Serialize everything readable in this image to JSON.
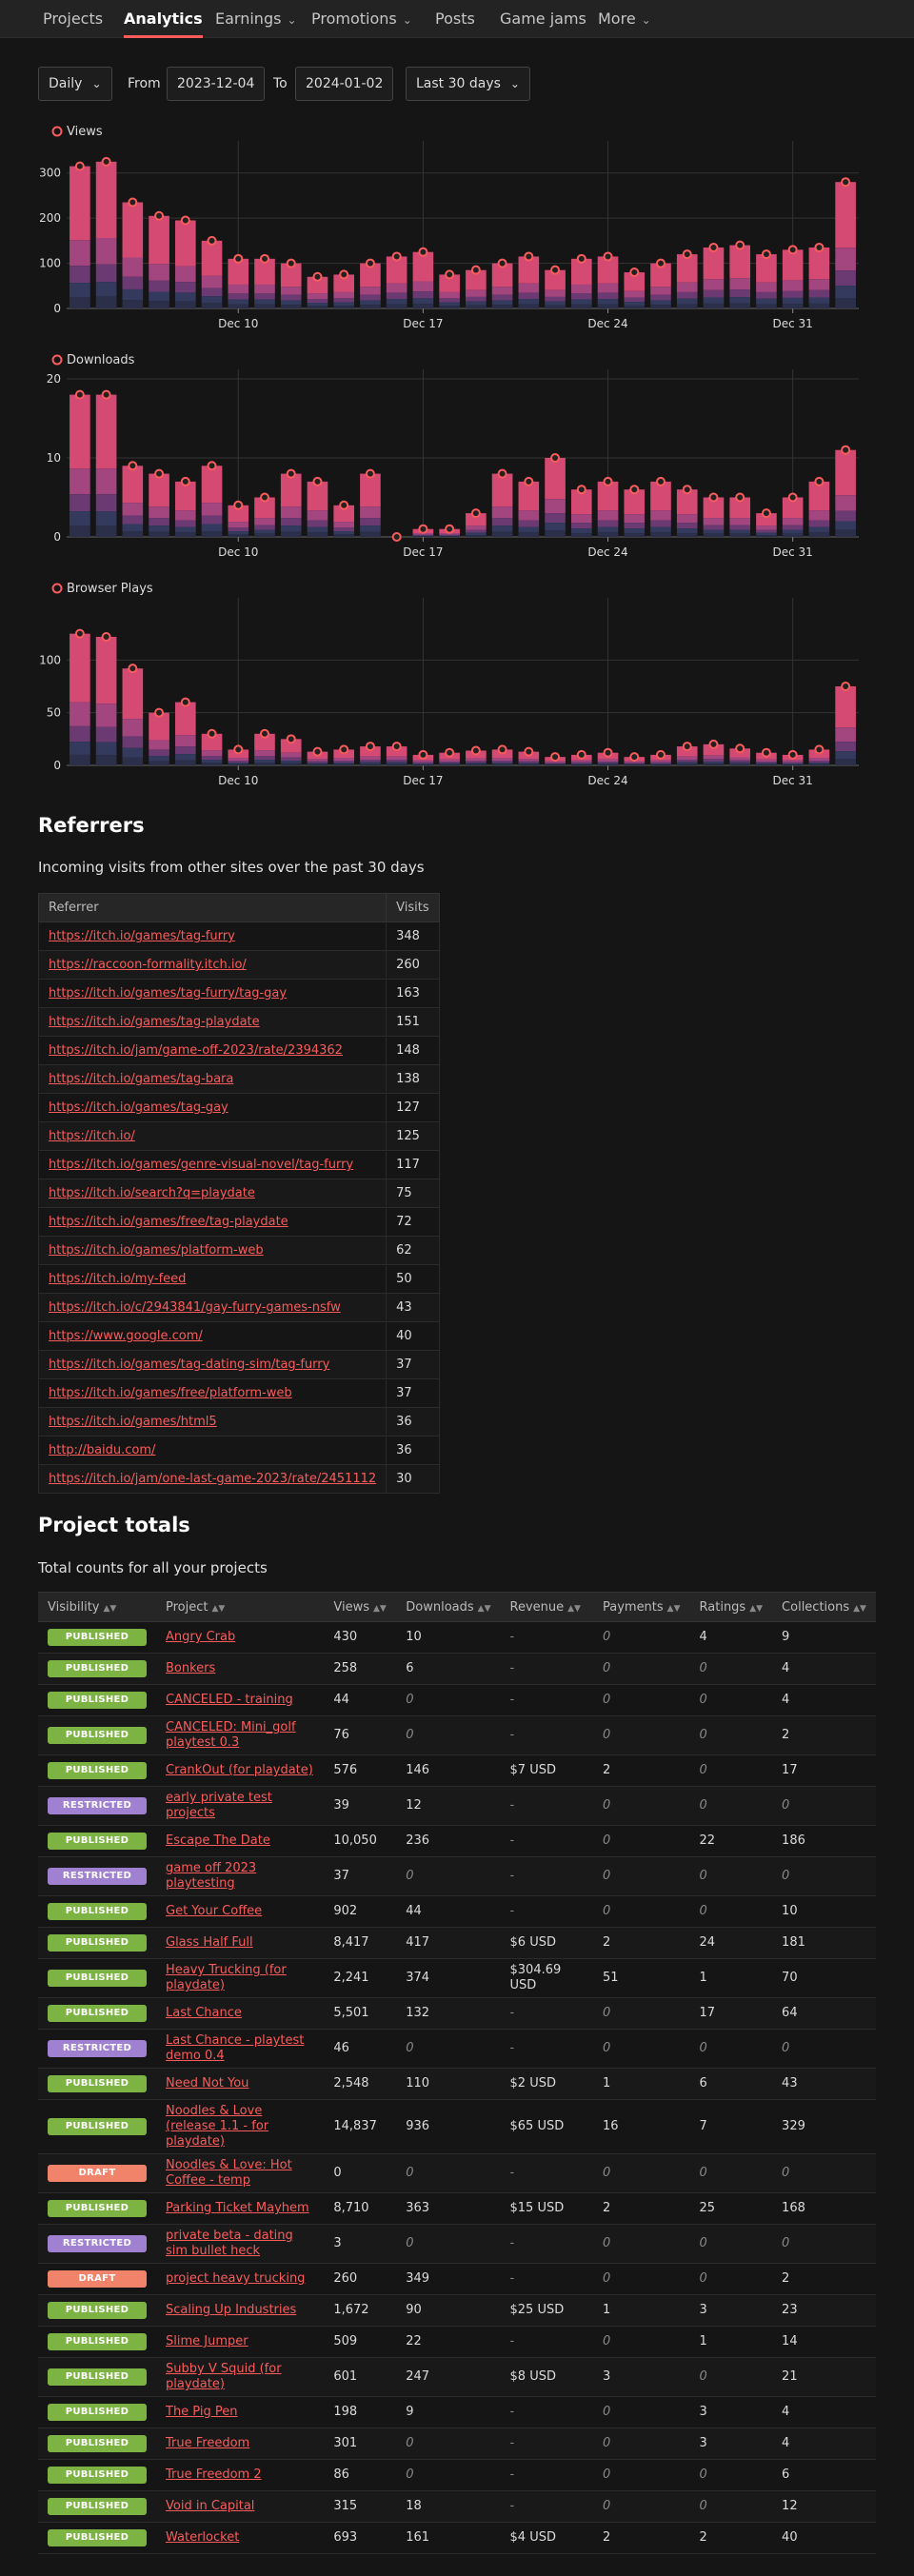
{
  "nav": {
    "items": [
      {
        "label": "Projects",
        "dropdown": false
      },
      {
        "label": "Analytics",
        "dropdown": false,
        "active": true
      },
      {
        "label": "Earnings",
        "dropdown": true
      },
      {
        "label": "Promotions",
        "dropdown": true
      },
      {
        "label": "Posts",
        "dropdown": false
      },
      {
        "label": "Game jams",
        "dropdown": false
      },
      {
        "label": "More",
        "dropdown": true
      }
    ]
  },
  "controls": {
    "interval": "Daily",
    "from_label": "From",
    "from_value": "2023-12-04",
    "to_label": "To",
    "to_value": "2024-01-02",
    "range": "Last 30 days"
  },
  "colors": {
    "accent": "#fa5c5c",
    "navy": "#333a5e",
    "purple": "#6b3a72",
    "published": "#7cb342",
    "restricted": "#a080d0",
    "draft": "#f2836b"
  },
  "chart_data": [
    {
      "type": "bar",
      "title": "Views",
      "categories": [
        "2023-12-04",
        "2023-12-05",
        "2023-12-06",
        "2023-12-07",
        "2023-12-08",
        "2023-12-09",
        "2023-12-10",
        "2023-12-11",
        "2023-12-12",
        "2023-12-13",
        "2023-12-14",
        "2023-12-15",
        "2023-12-16",
        "2023-12-17",
        "2023-12-18",
        "2023-12-19",
        "2023-12-20",
        "2023-12-21",
        "2023-12-22",
        "2023-12-23",
        "2023-12-24",
        "2023-12-25",
        "2023-12-26",
        "2023-12-27",
        "2023-12-28",
        "2023-12-29",
        "2023-12-30",
        "2023-12-31",
        "2024-01-01",
        "2024-01-02"
      ],
      "values": [
        315,
        325,
        235,
        205,
        195,
        150,
        110,
        110,
        100,
        70,
        75,
        100,
        115,
        125,
        75,
        85,
        100,
        115,
        85,
        110,
        115,
        80,
        100,
        120,
        135,
        140,
        120,
        130,
        135,
        280
      ],
      "xticks": [
        "Dec 10",
        "Dec 17",
        "Dec 24",
        "Dec 31"
      ],
      "ylim": [
        0,
        350
      ],
      "yticks": [
        0,
        100,
        200,
        300
      ],
      "stacked": true
    },
    {
      "type": "bar",
      "title": "Downloads",
      "categories": [
        "2023-12-04",
        "2023-12-05",
        "2023-12-06",
        "2023-12-07",
        "2023-12-08",
        "2023-12-09",
        "2023-12-10",
        "2023-12-11",
        "2023-12-12",
        "2023-12-13",
        "2023-12-14",
        "2023-12-15",
        "2023-12-16",
        "2023-12-17",
        "2023-12-18",
        "2023-12-19",
        "2023-12-20",
        "2023-12-21",
        "2023-12-22",
        "2023-12-23",
        "2023-12-24",
        "2023-12-25",
        "2023-12-26",
        "2023-12-27",
        "2023-12-28",
        "2023-12-29",
        "2023-12-30",
        "2023-12-31",
        "2024-01-01",
        "2024-01-02"
      ],
      "values": [
        18,
        18,
        9,
        8,
        7,
        9,
        4,
        5,
        8,
        7,
        4,
        8,
        0,
        1,
        1,
        3,
        8,
        7,
        10,
        6,
        7,
        6,
        7,
        6,
        5,
        5,
        3,
        5,
        7,
        11
      ],
      "xticks": [
        "Dec 10",
        "Dec 17",
        "Dec 24",
        "Dec 31"
      ],
      "ylim": [
        0,
        20
      ],
      "yticks": [
        0,
        10,
        20
      ],
      "stacked": true
    },
    {
      "type": "bar",
      "title": "Browser Plays",
      "categories": [
        "2023-12-04",
        "2023-12-05",
        "2023-12-06",
        "2023-12-07",
        "2023-12-08",
        "2023-12-09",
        "2023-12-10",
        "2023-12-11",
        "2023-12-12",
        "2023-12-13",
        "2023-12-14",
        "2023-12-15",
        "2023-12-16",
        "2023-12-17",
        "2023-12-18",
        "2023-12-19",
        "2023-12-20",
        "2023-12-21",
        "2023-12-22",
        "2023-12-23",
        "2023-12-24",
        "2023-12-25",
        "2023-12-26",
        "2023-12-27",
        "2023-12-28",
        "2023-12-29",
        "2023-12-30",
        "2023-12-31",
        "2024-01-01",
        "2024-01-02"
      ],
      "values": [
        125,
        122,
        92,
        50,
        60,
        30,
        15,
        30,
        25,
        13,
        15,
        18,
        18,
        10,
        12,
        14,
        15,
        13,
        8,
        10,
        12,
        8,
        10,
        18,
        20,
        16,
        12,
        10,
        15,
        75
      ],
      "xticks": [
        "Dec 10",
        "Dec 17",
        "Dec 24",
        "Dec 31"
      ],
      "ylim": [
        0,
        150
      ],
      "yticks": [
        0,
        50,
        100
      ],
      "stacked": true
    }
  ],
  "referrers": {
    "title": "Referrers",
    "subtitle": "Incoming visits from other sites over the past 30 days",
    "headers": [
      "Referrer",
      "Visits"
    ],
    "rows": [
      [
        "https://itch.io/games/tag-furry",
        "348"
      ],
      [
        "https://raccoon-formality.itch.io/",
        "260"
      ],
      [
        "https://itch.io/games/tag-furry/tag-gay",
        "163"
      ],
      [
        "https://itch.io/games/tag-playdate",
        "151"
      ],
      [
        "https://itch.io/jam/game-off-2023/rate/2394362",
        "148"
      ],
      [
        "https://itch.io/games/tag-bara",
        "138"
      ],
      [
        "https://itch.io/games/tag-gay",
        "127"
      ],
      [
        "https://itch.io/",
        "125"
      ],
      [
        "https://itch.io/games/genre-visual-novel/tag-furry",
        "117"
      ],
      [
        "https://itch.io/search?q=playdate",
        "75"
      ],
      [
        "https://itch.io/games/free/tag-playdate",
        "72"
      ],
      [
        "https://itch.io/games/platform-web",
        "62"
      ],
      [
        "https://itch.io/my-feed",
        "50"
      ],
      [
        "https://itch.io/c/2943841/gay-furry-games-nsfw",
        "43"
      ],
      [
        "https://www.google.com/",
        "40"
      ],
      [
        "https://itch.io/games/tag-dating-sim/tag-furry",
        "37"
      ],
      [
        "https://itch.io/games/free/platform-web",
        "37"
      ],
      [
        "https://itch.io/games/html5",
        "36"
      ],
      [
        "http://baidu.com/",
        "36"
      ],
      [
        "https://itch.io/jam/one-last-game-2023/rate/2451112",
        "30"
      ]
    ]
  },
  "projects": {
    "title": "Project totals",
    "subtitle": "Total counts for all your projects",
    "headers": [
      "Visibility",
      "Project",
      "Views",
      "Downloads",
      "Revenue",
      "Payments",
      "Ratings",
      "Collections"
    ],
    "rows": [
      [
        "PUBLISHED",
        "Angry Crab",
        "430",
        "10",
        "-",
        "0",
        "4",
        "9"
      ],
      [
        "PUBLISHED",
        "Bonkers",
        "258",
        "6",
        "-",
        "0",
        "0",
        "4"
      ],
      [
        "PUBLISHED",
        "CANCELED - training",
        "44",
        "0",
        "-",
        "0",
        "0",
        "4"
      ],
      [
        "PUBLISHED",
        "CANCELED: Mini_golf playtest 0.3",
        "76",
        "0",
        "-",
        "0",
        "0",
        "2"
      ],
      [
        "PUBLISHED",
        "CrankOut (for playdate)",
        "576",
        "146",
        "$7 USD",
        "2",
        "0",
        "17"
      ],
      [
        "RESTRICTED",
        "early private test projects",
        "39",
        "12",
        "-",
        "0",
        "0",
        "0"
      ],
      [
        "PUBLISHED",
        "Escape The Date",
        "10,050",
        "236",
        "-",
        "0",
        "22",
        "186"
      ],
      [
        "RESTRICTED",
        "game off 2023 playtesting",
        "37",
        "0",
        "-",
        "0",
        "0",
        "0"
      ],
      [
        "PUBLISHED",
        "Get Your Coffee",
        "902",
        "44",
        "-",
        "0",
        "0",
        "10"
      ],
      [
        "PUBLISHED",
        "Glass Half Full",
        "8,417",
        "417",
        "$6 USD",
        "2",
        "24",
        "181"
      ],
      [
        "PUBLISHED",
        "Heavy Trucking (for playdate)",
        "2,241",
        "374",
        "$304.69 USD",
        "51",
        "1",
        "70"
      ],
      [
        "PUBLISHED",
        "Last Chance",
        "5,501",
        "132",
        "-",
        "0",
        "17",
        "64"
      ],
      [
        "RESTRICTED",
        "Last Chance - playtest demo 0.4",
        "46",
        "0",
        "-",
        "0",
        "0",
        "0"
      ],
      [
        "PUBLISHED",
        "Need Not You",
        "2,548",
        "110",
        "$2 USD",
        "1",
        "6",
        "43"
      ],
      [
        "PUBLISHED",
        "Noodles & Love (release 1.1 - for playdate)",
        "14,837",
        "936",
        "$65 USD",
        "16",
        "7",
        "329"
      ],
      [
        "DRAFT",
        "Noodles & Love: Hot Coffee - temp",
        "0",
        "0",
        "-",
        "0",
        "0",
        "0"
      ],
      [
        "PUBLISHED",
        "Parking Ticket Mayhem",
        "8,710",
        "363",
        "$15 USD",
        "2",
        "25",
        "168"
      ],
      [
        "RESTRICTED",
        "private beta - dating sim bullet heck",
        "3",
        "0",
        "-",
        "0",
        "0",
        "0"
      ],
      [
        "DRAFT",
        "project heavy trucking",
        "260",
        "349",
        "-",
        "0",
        "0",
        "2"
      ],
      [
        "PUBLISHED",
        "Scaling Up Industries",
        "1,672",
        "90",
        "$25 USD",
        "1",
        "3",
        "23"
      ],
      [
        "PUBLISHED",
        "Slime Jumper",
        "509",
        "22",
        "-",
        "0",
        "1",
        "14"
      ],
      [
        "PUBLISHED",
        "Subby V Squid (for playdate)",
        "601",
        "247",
        "$8 USD",
        "3",
        "0",
        "21"
      ],
      [
        "PUBLISHED",
        "The Pig Pen",
        "198",
        "9",
        "-",
        "0",
        "3",
        "4"
      ],
      [
        "PUBLISHED",
        "True Freedom",
        "301",
        "0",
        "-",
        "0",
        "3",
        "4"
      ],
      [
        "PUBLISHED",
        "True Freedom 2",
        "86",
        "0",
        "-",
        "0",
        "0",
        "6"
      ],
      [
        "PUBLISHED",
        "Void in Capital",
        "315",
        "18",
        "-",
        "0",
        "0",
        "12"
      ],
      [
        "PUBLISHED",
        "Waterlocket",
        "693",
        "161",
        "$4 USD",
        "2",
        "2",
        "40"
      ]
    ]
  }
}
